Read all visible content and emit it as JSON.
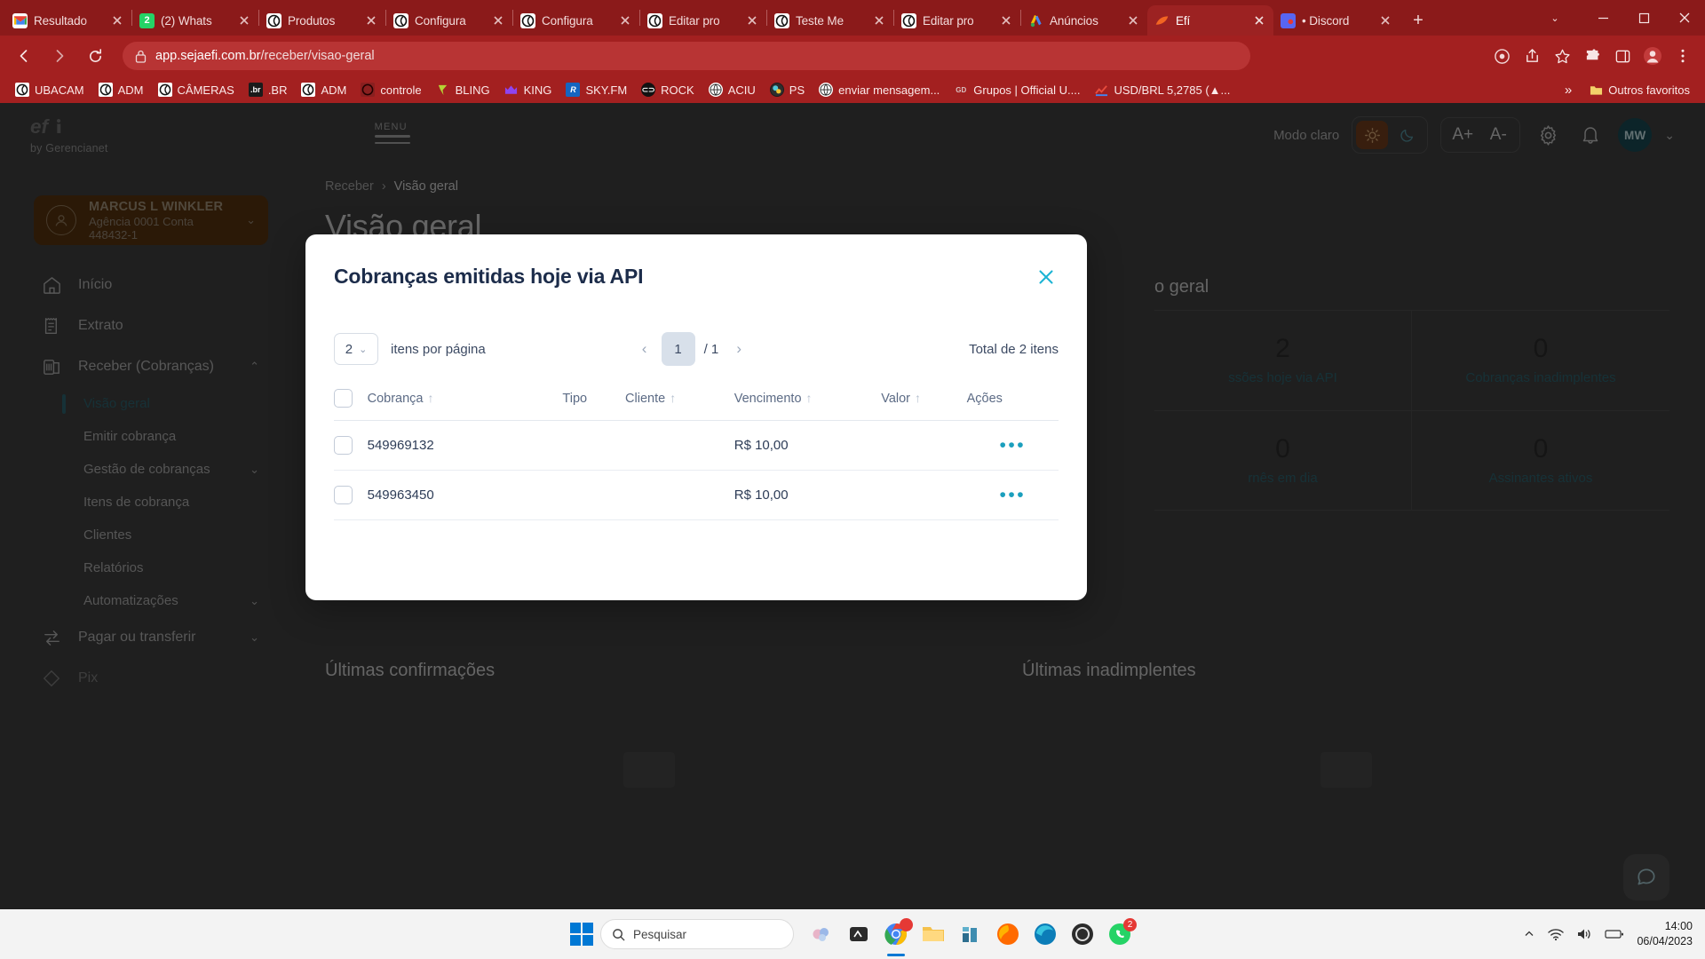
{
  "browser": {
    "tabs": [
      {
        "title": "Resultado",
        "icon": "gmail-icon",
        "active": false
      },
      {
        "title": "(2) Whats",
        "icon": "whatsapp-icon",
        "active": false,
        "badge": "2"
      },
      {
        "title": "Produtos",
        "icon": "chrome-circle-icon",
        "active": false
      },
      {
        "title": "Configura",
        "icon": "chrome-circle-icon",
        "active": false
      },
      {
        "title": "Configura",
        "icon": "chrome-circle-icon",
        "active": false
      },
      {
        "title": "Editar pro",
        "icon": "chrome-circle-icon",
        "active": false
      },
      {
        "title": "Teste Me",
        "icon": "chrome-circle-icon",
        "active": false
      },
      {
        "title": "Editar pro",
        "icon": "chrome-circle-icon",
        "active": false
      },
      {
        "title": "Anúncios",
        "icon": "google-ads-icon",
        "active": false
      },
      {
        "title": "Efí",
        "icon": "efi-icon",
        "active": true
      },
      {
        "title": "• Discord",
        "icon": "discord-icon",
        "active": false
      }
    ],
    "new_tab_label": "+",
    "url": "app.sejaefi.com.br",
    "url_path": "/receber/visao-geral",
    "bookmarks": [
      {
        "label": "UBACAM",
        "icon": "chrome-circle-icon"
      },
      {
        "label": "ADM",
        "icon": "chrome-circle-icon"
      },
      {
        "label": "CÂMERAS",
        "icon": "chrome-circle-icon"
      },
      {
        "label": ".BR",
        "icon": "registrobr-icon"
      },
      {
        "label": "ADM",
        "icon": "chrome-circle-icon"
      },
      {
        "label": "controle",
        "icon": "chrome-circle-icon"
      },
      {
        "label": "BLING",
        "icon": "bling-icon"
      },
      {
        "label": "KING",
        "icon": "crown-icon"
      },
      {
        "label": "SKY.FM",
        "icon": "skyfm-icon"
      },
      {
        "label": "ROCK",
        "icon": "rock-icon"
      },
      {
        "label": "ACIU",
        "icon": "globe-icon"
      },
      {
        "label": "PS",
        "icon": "ps-icon"
      },
      {
        "label": "enviar mensagem...",
        "icon": "globe-icon"
      },
      {
        "label": "Grupos | Official U....",
        "icon": "gd-icon"
      },
      {
        "label": "USD/BRL 5,2785 (▲...",
        "icon": "chart-icon"
      }
    ],
    "bookmarks_overflow": "»",
    "other_bookmarks": "Outros favoritos"
  },
  "app": {
    "brand": "efí",
    "brand_sub": "by Gerencianet",
    "menu_label": "MENU",
    "header": {
      "theme_label": "Modo claro",
      "font_increase": "A+",
      "font_decrease": "A-",
      "avatar_initials": "MW"
    },
    "account": {
      "name": "MARCUS L WINKLER",
      "details": "Agência 0001  Conta 448432-1"
    },
    "nav": [
      {
        "label": "Início",
        "icon": "home-icon",
        "has_caret": false
      },
      {
        "label": "Extrato",
        "icon": "receipt-icon",
        "has_caret": false
      },
      {
        "label": "Receber (Cobranças)",
        "icon": "invoice-icon",
        "has_caret": true,
        "expanded": true
      },
      {
        "label": "Pagar ou transferir",
        "icon": "transfer-icon",
        "has_caret": true
      }
    ],
    "subnav": [
      {
        "label": "Visão geral",
        "active": true,
        "has_caret": false
      },
      {
        "label": "Emitir cobrança",
        "active": false,
        "has_caret": false
      },
      {
        "label": "Gestão de cobranças",
        "active": false,
        "has_caret": true
      },
      {
        "label": "Itens de cobrança",
        "active": false,
        "has_caret": false
      },
      {
        "label": "Clientes",
        "active": false,
        "has_caret": false
      },
      {
        "label": "Relatórios",
        "active": false,
        "has_caret": false
      },
      {
        "label": "Automatizações",
        "active": false,
        "has_caret": true
      }
    ],
    "breadcrumb": {
      "parent": "Receber",
      "sep": "›",
      "current": "Visão geral"
    },
    "page_title": "Visão geral",
    "overview_panel_title": "o geral",
    "stats": [
      {
        "value": "2",
        "label": "ssões hoje via API"
      },
      {
        "value": "0",
        "label": "Cobranças inadimplentes"
      },
      {
        "value": "0",
        "label": "rnês em dia"
      },
      {
        "value": "0",
        "label": "Assinantes ativos"
      }
    ],
    "lower_panels": [
      {
        "title": "Últimas confirmações"
      },
      {
        "title": "Últimas inadimplentes"
      }
    ]
  },
  "modal": {
    "title": "Cobranças emitidas hoje via API",
    "close_icon": "close-icon",
    "per_page_value": "2",
    "per_page_label": "itens por página",
    "prev_icon": "chevron-left-icon",
    "next_icon": "chevron-right-icon",
    "current_page": "1",
    "total_pages": "/ 1",
    "total_label": "Total de 2 itens",
    "columns": [
      {
        "label": "Cobrança",
        "sortable": true
      },
      {
        "label": "Tipo",
        "sortable": false
      },
      {
        "label": "Cliente",
        "sortable": true
      },
      {
        "label": "Vencimento",
        "sortable": true
      },
      {
        "label": "Valor",
        "sortable": true
      },
      {
        "label": "Ações",
        "sortable": false
      }
    ],
    "rows": [
      {
        "cobranca": "549969132",
        "tipo": "",
        "cliente": "",
        "vencimento": "R$ 10,00",
        "valor": "",
        "acoes": "•••"
      },
      {
        "cobranca": "549963450",
        "tipo": "",
        "cliente": "",
        "vencimento": "R$ 10,00",
        "valor": "",
        "acoes": "•••"
      }
    ]
  },
  "taskbar": {
    "search_placeholder": "Pesquisar",
    "apps": [
      {
        "name": "start-button"
      },
      {
        "name": "widgets-icon"
      },
      {
        "name": "teams-icon"
      },
      {
        "name": "chrome-icon",
        "badge": "",
        "active": true
      },
      {
        "name": "file-explorer-icon"
      },
      {
        "name": "store-icon"
      },
      {
        "name": "firefox-icon"
      },
      {
        "name": "edge-icon"
      },
      {
        "name": "obs-icon"
      },
      {
        "name": "whatsapp-icon",
        "badge": "2"
      }
    ],
    "time": "14:00",
    "date": "06/04/2023"
  },
  "colors": {
    "browser_red": "#a32020",
    "tabstrip_red": "#8b1a1a",
    "accent_teal": "#2b5f6a",
    "modal_accent": "#1b9fbd",
    "account_brown": "#53300f"
  }
}
